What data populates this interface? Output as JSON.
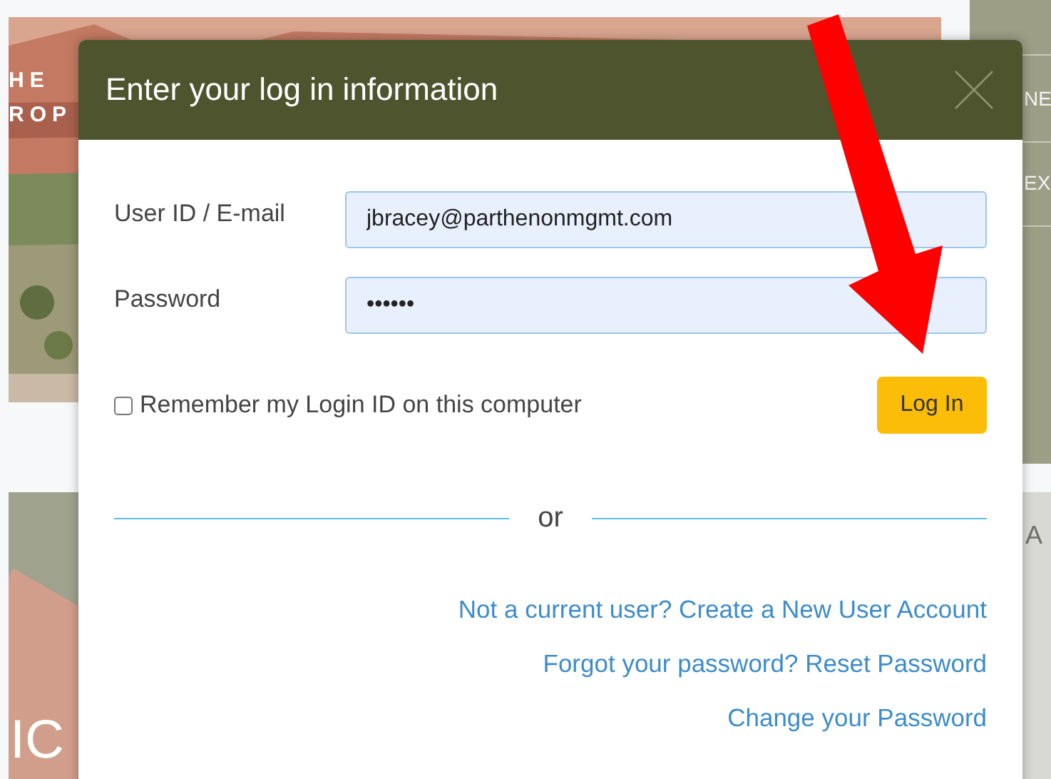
{
  "background": {
    "hero_text": [
      "HE",
      "ROP"
    ],
    "side_menu": [
      "NE",
      "EX"
    ],
    "side_lower_text": "A",
    "banner_text": "IC"
  },
  "dialog": {
    "title": "Enter your log in information",
    "fields": [
      {
        "label": "User ID / E-mail",
        "value": "jbracey@parthenonmgmt.com"
      },
      {
        "label": "Password",
        "value": "••••••"
      }
    ],
    "remember": {
      "label": "Remember my Login ID on this computer",
      "checked": false
    },
    "login_button": "Log In",
    "separator": "or",
    "links": [
      {
        "text": "Not a current user? Create a New User Account"
      },
      {
        "text": "Forgot your password? Reset Password"
      },
      {
        "text": "Change your Password"
      }
    ]
  }
}
